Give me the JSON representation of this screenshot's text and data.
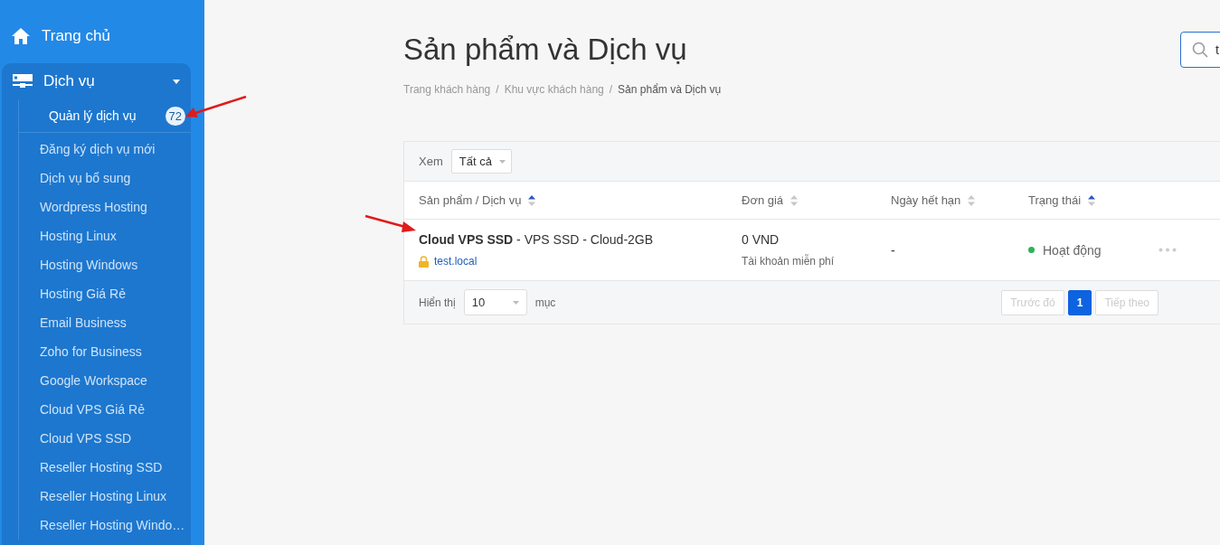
{
  "sidebar": {
    "home": {
      "label": "Trang chủ"
    },
    "group": {
      "label": "Dịch vụ",
      "expanded": true,
      "items": [
        {
          "label": "Quản lý dịch vụ",
          "selected": true,
          "badge": "72"
        },
        {
          "label": "Đăng ký dịch vụ mới",
          "selected": false
        },
        {
          "label": "Dịch vụ bổ sung",
          "selected": false
        },
        {
          "label": "Wordpress Hosting",
          "selected": false
        },
        {
          "label": "Hosting Linux",
          "selected": false
        },
        {
          "label": "Hosting Windows",
          "selected": false
        },
        {
          "label": "Hosting Giá Rẻ",
          "selected": false
        },
        {
          "label": "Email Business",
          "selected": false
        },
        {
          "label": "Zoho for Business",
          "selected": false
        },
        {
          "label": "Google Workspace",
          "selected": false
        },
        {
          "label": "Cloud VPS Giá Rẻ",
          "selected": false
        },
        {
          "label": "Cloud VPS SSD",
          "selected": false
        },
        {
          "label": "Reseller Hosting SSD",
          "selected": false
        },
        {
          "label": "Reseller Hosting Linux",
          "selected": false
        },
        {
          "label": "Reseller Hosting Windo…",
          "selected": false
        }
      ]
    }
  },
  "page": {
    "title": "Sản phẩm và Dịch vụ",
    "search": {
      "value": "t"
    },
    "breadcrumb": {
      "separator": "/",
      "items": [
        {
          "label": "Trang khách hàng",
          "current": false
        },
        {
          "label": "Khu vực khách hàng",
          "current": false
        },
        {
          "label": "Sản phẩm và Dịch vụ",
          "current": true
        }
      ]
    }
  },
  "table": {
    "filter": {
      "label": "Xem",
      "value": "Tất cả"
    },
    "columns": [
      {
        "label": "Sản phẩm / Dịch vụ",
        "sorted": true
      },
      {
        "label": "Đơn giá",
        "sorted": false
      },
      {
        "label": "Ngày hết hạn",
        "sorted": false
      },
      {
        "label": "Trạng thái",
        "sorted": true
      }
    ],
    "rows": [
      {
        "product": "**Cloud VPS SSD** - VPS SSD - Cloud-2GB",
        "domain": "test.local",
        "price": "0 VND",
        "price_note": "Tài khoản miễn phí",
        "expiry": "-",
        "status": "Hoạt động",
        "color": "#2fb25a"
      }
    ],
    "footer": {
      "show_label": "Hiển thị",
      "page_size": "10",
      "unit": "mục",
      "pager": [
        {
          "label": "Trước đó",
          "disabled": true,
          "selected": false
        },
        {
          "label": "1",
          "disabled": false,
          "selected": true
        },
        {
          "label": "Tiếp theo",
          "disabled": true,
          "selected": false
        }
      ]
    }
  }
}
